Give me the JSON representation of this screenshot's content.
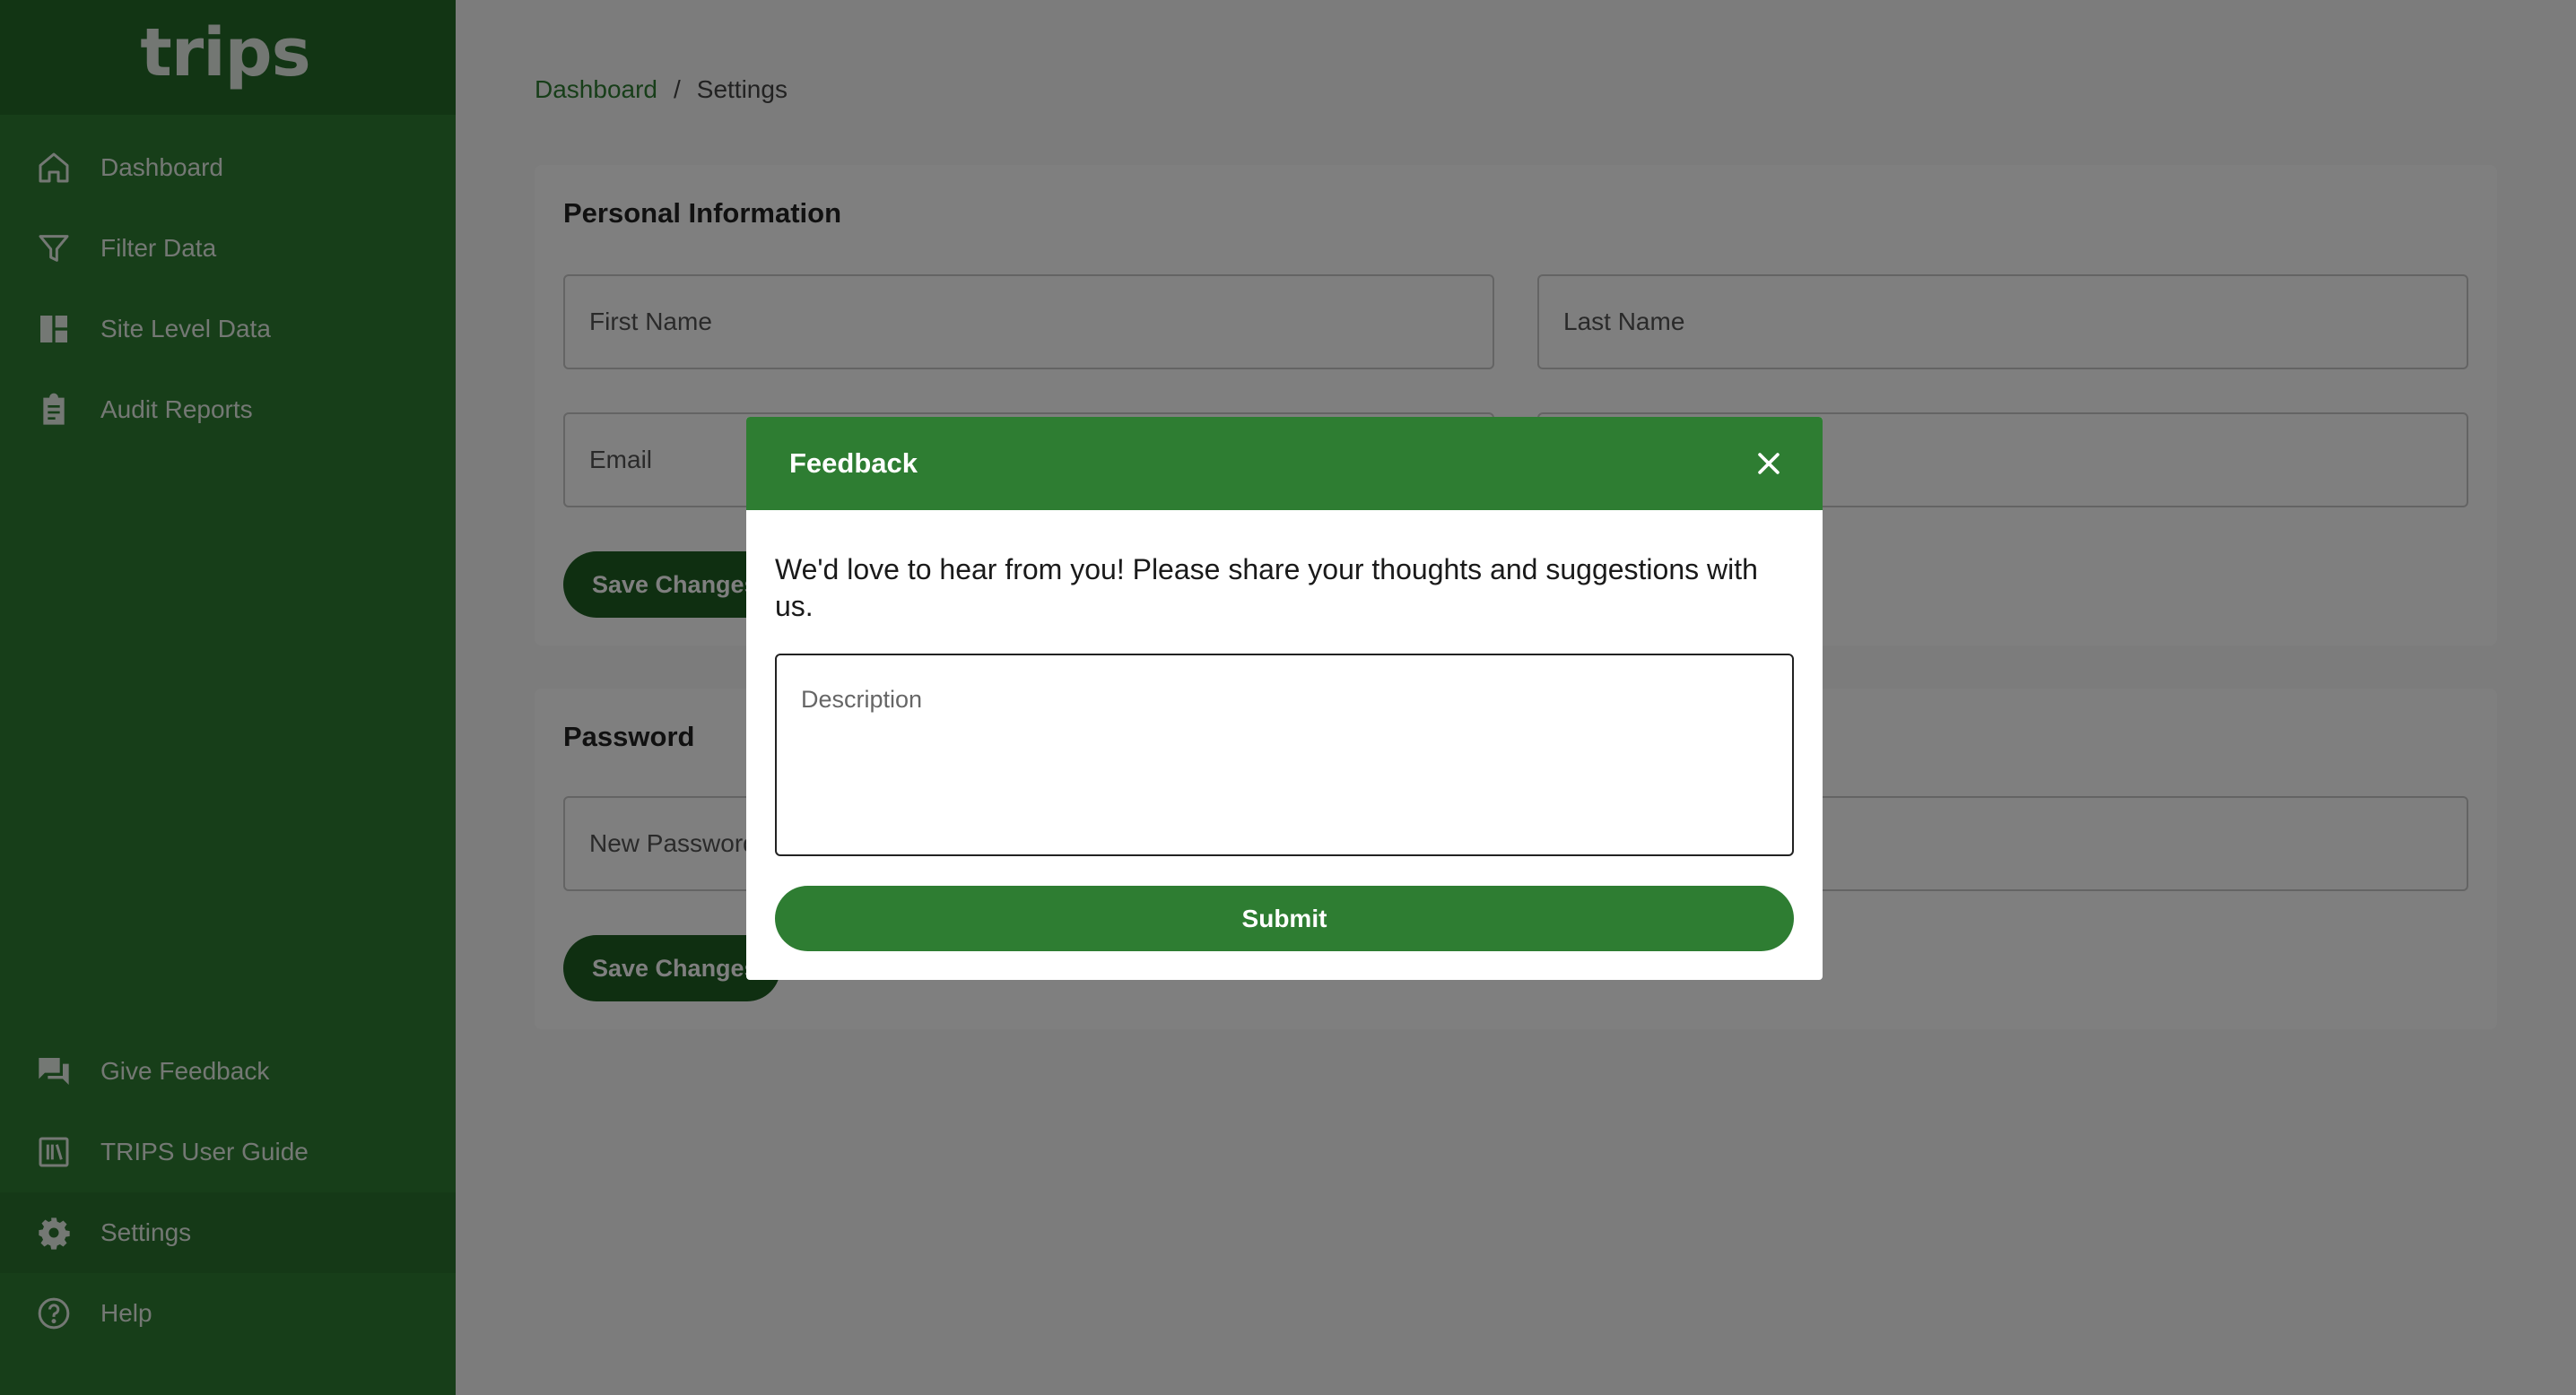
{
  "app": {
    "logo": "trips"
  },
  "sidebar": {
    "items": [
      {
        "label": "Dashboard",
        "icon": "home-icon"
      },
      {
        "label": "Filter Data",
        "icon": "filter-icon"
      },
      {
        "label": "Site Level Data",
        "icon": "dashboard-grid-icon"
      },
      {
        "label": "Audit Reports",
        "icon": "clipboard-icon"
      }
    ],
    "bottom_items": [
      {
        "label": "Give Feedback",
        "icon": "feedback-icon"
      },
      {
        "label": "TRIPS User Guide",
        "icon": "book-icon"
      },
      {
        "label": "Settings",
        "icon": "gear-icon",
        "active": true
      },
      {
        "label": "Help",
        "icon": "help-icon"
      }
    ]
  },
  "breadcrumb": {
    "root": "Dashboard",
    "separator": "/",
    "current": "Settings"
  },
  "personal": {
    "title": "Personal Information",
    "first_name_placeholder": "First Name",
    "last_name_placeholder": "Last Name",
    "email_placeholder": "Email",
    "save_label": "Save Changes"
  },
  "password": {
    "title": "Password",
    "new_password_placeholder": "New Password",
    "save_label": "Save Changes"
  },
  "modal": {
    "title": "Feedback",
    "message": "We'd love to hear from you! Please share your thoughts and suggestions with us.",
    "description_placeholder": "Description",
    "submit_label": "Submit"
  },
  "colors": {
    "primary": "#2e7d32",
    "primary_dark": "#1f5e23",
    "overlay": "rgba(0,0,0,0.5)"
  }
}
